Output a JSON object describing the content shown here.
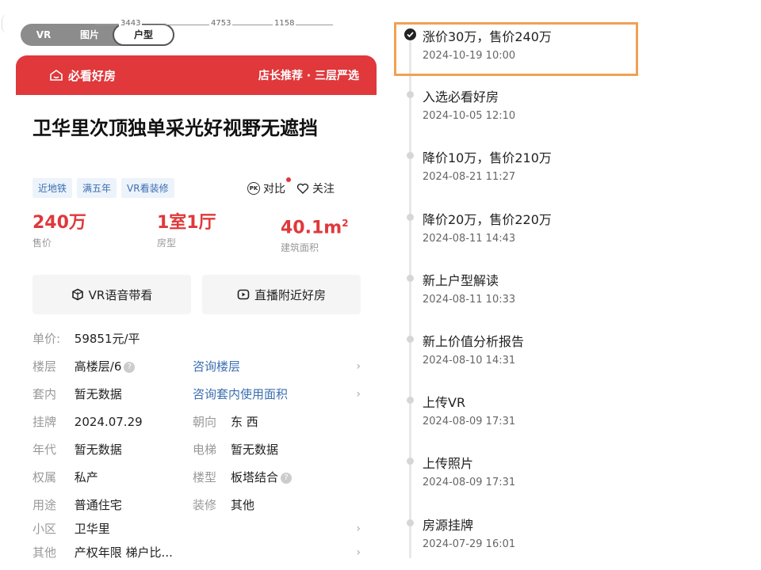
{
  "media_tabs": [
    "VR",
    "图片",
    "户型"
  ],
  "dimensions": [
    "3443",
    "4753",
    "1158"
  ],
  "header": {
    "badge": "必看好房",
    "right": "店长推荐 · 三层严选"
  },
  "listing": {
    "title": "卫华里次顶独单采光好视野无遮挡",
    "tags": [
      "近地铁",
      "满五年",
      "VR看装修"
    ],
    "compare_label": "对比",
    "compare_icon_text": "PK",
    "follow_label": "关注",
    "stats": [
      {
        "value": "240万",
        "label": "售价"
      },
      {
        "value": "1室1厅",
        "label": "房型"
      },
      {
        "value": "40.1m",
        "sup": "2",
        "label": "建筑面积"
      }
    ],
    "buttons": [
      "VR语音带看",
      "直播附近好房"
    ]
  },
  "info": {
    "unit_price": {
      "label": "单价:",
      "value": "59851元/平"
    },
    "floor": {
      "label": "楼层",
      "value": "高楼层/6",
      "link": "咨询楼层"
    },
    "inner": {
      "label": "套内",
      "value": "暂无数据",
      "link": "咨询套内使用面积"
    },
    "listed": {
      "label": "挂牌",
      "value": "2024.07.29"
    },
    "orient": {
      "label": "朝向",
      "value": "东 西"
    },
    "year": {
      "label": "年代",
      "value": "暂无数据"
    },
    "elevator": {
      "label": "电梯",
      "value": "暂无数据"
    },
    "ownership": {
      "label": "权属",
      "value": "私产"
    },
    "type": {
      "label": "楼型",
      "value": "板塔结合"
    },
    "usage": {
      "label": "用途",
      "value": "普通住宅"
    },
    "decor": {
      "label": "装修",
      "value": "其他"
    },
    "community": {
      "label": "小区",
      "value": "卫华里"
    },
    "other": {
      "label": "其他",
      "value": "产权年限 梯户比..."
    }
  },
  "timeline": [
    {
      "event": "涨价30万，售价240万",
      "time": "2024-10-19 10:00",
      "current": true
    },
    {
      "event": "入选必看好房",
      "time": "2024-10-05 12:10"
    },
    {
      "event": "降价10万，售价210万",
      "time": "2024-08-21 11:27"
    },
    {
      "event": "降价20万，售价220万",
      "time": "2024-08-11 14:43"
    },
    {
      "event": "新上户型解读",
      "time": "2024-08-11 10:33"
    },
    {
      "event": "新上价值分析报告",
      "time": "2024-08-10 14:31"
    },
    {
      "event": "上传VR",
      "time": "2024-08-09 17:31"
    },
    {
      "event": "上传照片",
      "time": "2024-08-09 17:31"
    },
    {
      "event": "房源挂牌",
      "time": "2024-07-29 16:01"
    }
  ],
  "colors": {
    "accent": "#e0383b",
    "link": "#3b6fb0",
    "highlight": "#f0a154"
  }
}
